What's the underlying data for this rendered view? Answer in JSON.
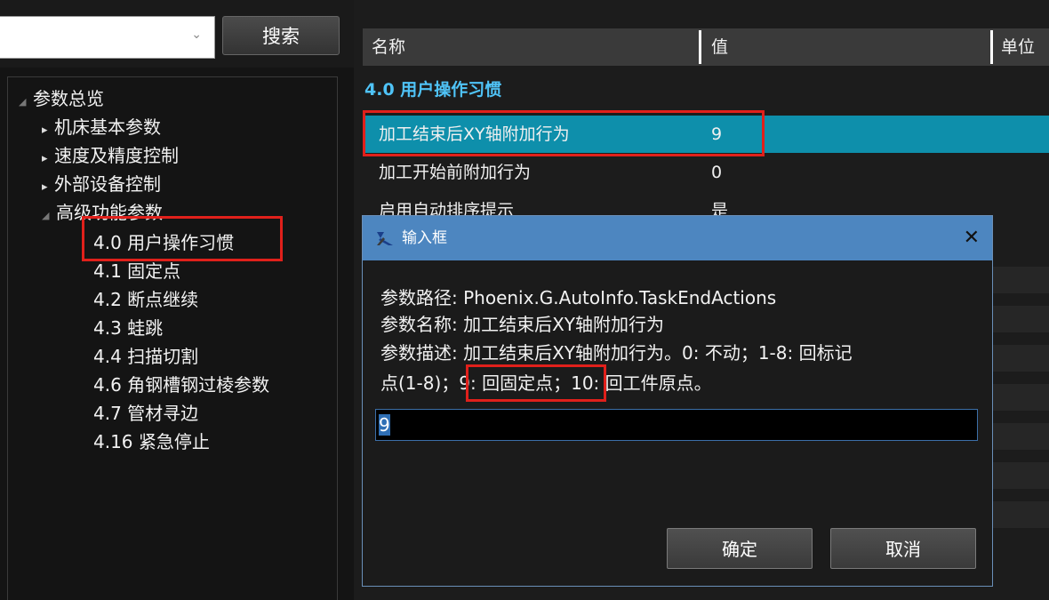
{
  "search": {
    "button_label": "搜索"
  },
  "tree": {
    "root": "参数总览",
    "items": [
      "机床基本参数",
      "速度及精度控制",
      "外部设备控制"
    ],
    "advanced": "高级功能参数",
    "children": [
      "4.0 用户操作习惯",
      "4.1 固定点",
      "4.2 断点继续",
      "4.3 蛙跳",
      "4.4 扫描切割",
      "4.6 角钢槽钢过棱参数",
      "4.7 管材寻边",
      "4.16 紧急停止"
    ]
  },
  "grid": {
    "columns": [
      "名称",
      "值",
      "单位"
    ],
    "group_title": "4.0 用户操作习惯",
    "rows": [
      {
        "name": "加工结束后XY轴附加行为",
        "value": "9"
      },
      {
        "name": "加工开始前附加行为",
        "value": "0"
      },
      {
        "name": "启用自动排序提示",
        "value": "是"
      }
    ]
  },
  "dialog": {
    "title": "输入框",
    "path_line": "参数路径: Phoenix.G.AutoInfo.TaskEndActions",
    "name_line": "参数名称: 加工结束后XY轴附加行为",
    "desc_line1": "参数描述: 加工结束后XY轴附加行为。0: 不动；1-8: 回标记",
    "desc_line2_a": "点(1-8)；",
    "desc_line2_b": "9: 回固定点；",
    "desc_line2_c": "10: 回工件原点。",
    "input_value": "9",
    "ok_label": "确定",
    "cancel_label": "取消"
  },
  "colors": {
    "highlight_box": "#e0201b",
    "selected_row": "#0e8fab",
    "dialog_title": "#4d86c0",
    "group_title": "#4fc3f7"
  }
}
